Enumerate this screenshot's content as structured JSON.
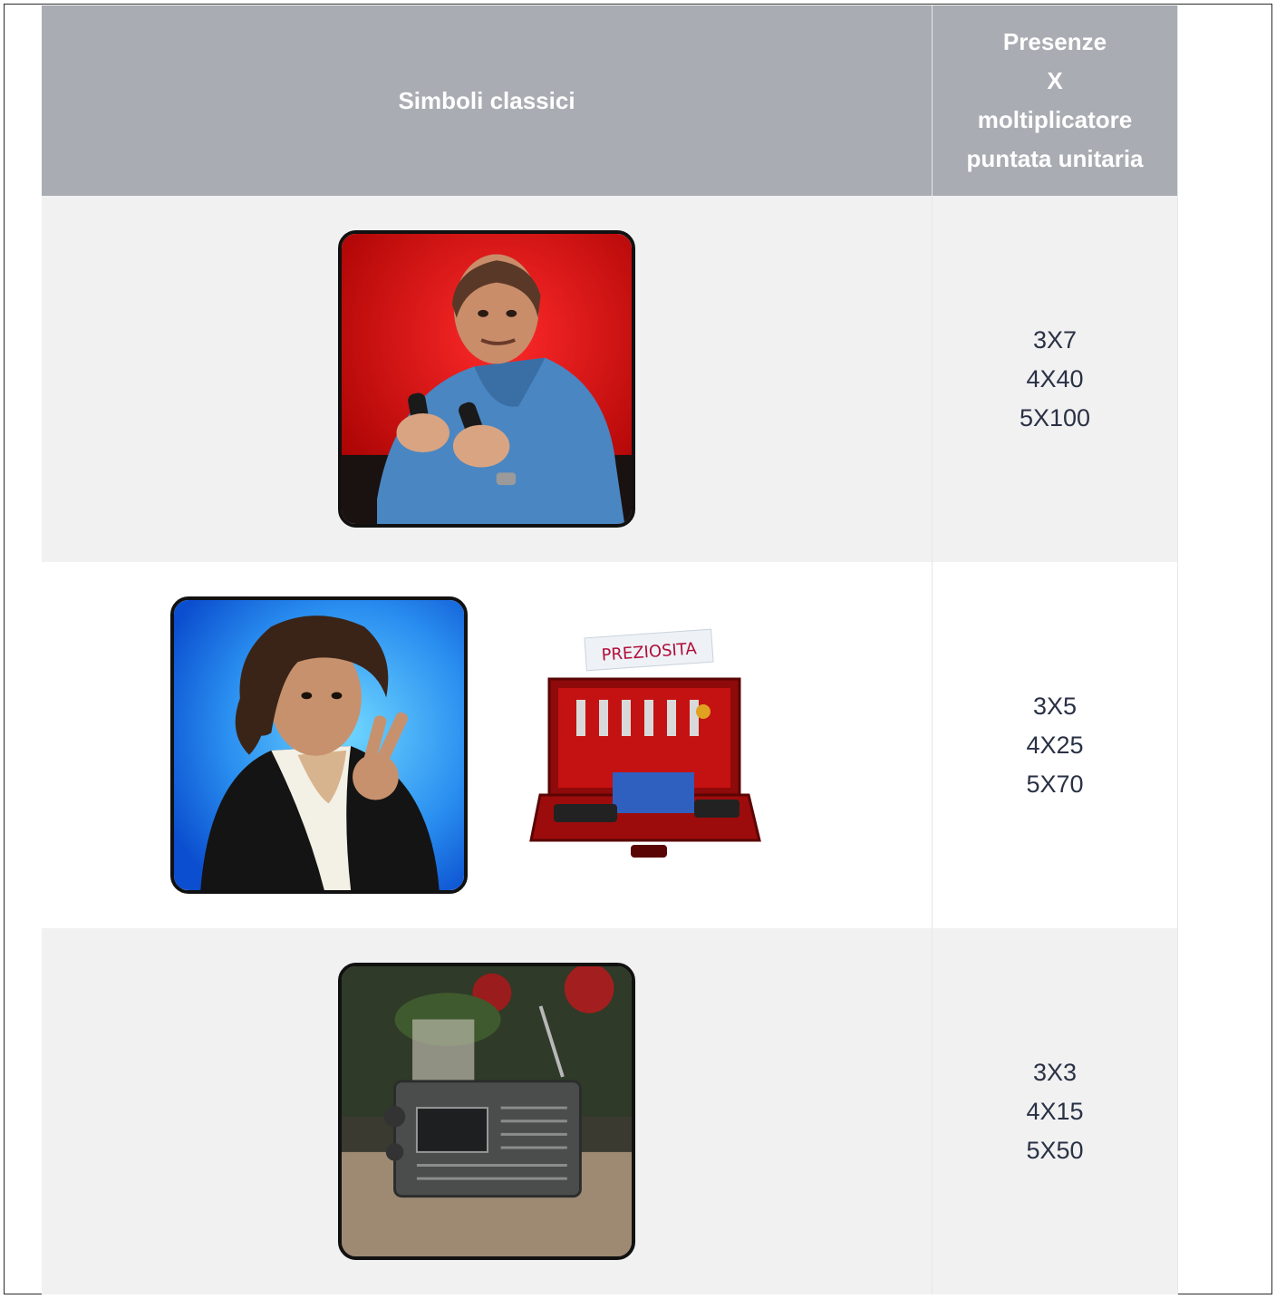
{
  "table": {
    "header": {
      "symbols": "Simboli classici",
      "payout_lines": [
        "Presenze",
        "X",
        "moltiplicatore",
        "puntata unitaria"
      ]
    },
    "rows": [
      {
        "symbols": [
          "man-blue-sweater-red-bg"
        ],
        "payouts": [
          "3X7",
          "4X40",
          "5X100"
        ]
      },
      {
        "symbols": [
          "man-peace-sign-blue-bg",
          "briefcase-preziosita"
        ],
        "label": "PREZIOSITA",
        "payouts": [
          "3X5",
          "4X25",
          "5X70"
        ]
      },
      {
        "symbols": [
          "vintage-radio"
        ],
        "payouts": [
          "3X3",
          "4X15",
          "5X50"
        ]
      }
    ]
  },
  "colors": {
    "header_bg": "#a9acb2",
    "row_alt_bg": "#f1f1f2",
    "text": "#2a3145"
  }
}
